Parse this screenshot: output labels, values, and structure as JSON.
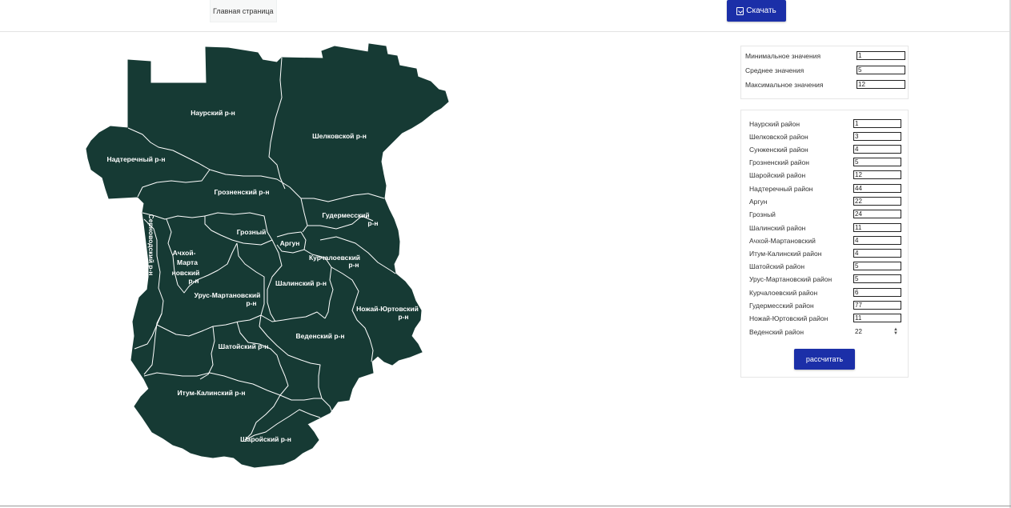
{
  "header": {
    "home_label": "Главная страница",
    "download_label": "Скачать"
  },
  "colors": {
    "map_fill": "#163a34",
    "border": "#ffffff",
    "accent_button": "#1b2fa8"
  },
  "map": {
    "labels": {
      "naur": "Наурский р-н",
      "shelk": "Шелковской р-н",
      "nadter": "Надтеречный р-н",
      "grozn_r": "Грозненский р-н",
      "gud_1": "Гудермесский",
      "gud_2": "р-н",
      "grozny": "Грозный",
      "argun": "Аргун",
      "sunzh": "Серноводский р-н",
      "achkh_1": "Ачхой-",
      "achkh_2": "Марта",
      "achkh_3": "новский",
      "achkh_4": "р-н",
      "kurch_1": "Курчалоевский",
      "kurch_2": "р-н",
      "shalin": "Шалинский р-н",
      "urus_1": "Урус-Мартановский",
      "urus_2": "р-н",
      "nozh_1": "Ножай-Юртовский",
      "nozh_2": "р-н",
      "veden": "Веденский р-н",
      "shatoi": "Шатойский р-н",
      "itum": "Итум-Калинский р-н",
      "sharoi": "Шаройский р-н"
    }
  },
  "thresholds": [
    {
      "label": "Минимальное значения",
      "value": "1"
    },
    {
      "label": "Среднее значения",
      "value": "5"
    },
    {
      "label": "Максимальное значения",
      "value": "12"
    }
  ],
  "districts": [
    {
      "label": "Наурский район",
      "value": "1"
    },
    {
      "label": "Шелковской район",
      "value": "3"
    },
    {
      "label": "Сунженский район",
      "value": "4"
    },
    {
      "label": "Грозненский район",
      "value": "5"
    },
    {
      "label": "Шаройский район",
      "value": "12"
    },
    {
      "label": "Надтеречный район",
      "value": "44"
    },
    {
      "label": "Аргун",
      "value": "22"
    },
    {
      "label": "Грозный",
      "value": "24"
    },
    {
      "label": "Шалинский район",
      "value": "11"
    },
    {
      "label": "Ачхой-Мартановский",
      "value": "4"
    },
    {
      "label": "Итум-Калинский район",
      "value": "4"
    },
    {
      "label": "Шатойский район",
      "value": "5"
    },
    {
      "label": "Урус-Мартановский район",
      "value": "5"
    },
    {
      "label": "Курчалоевский район",
      "value": "6"
    },
    {
      "label": "Гудермесский район",
      "value": "77"
    },
    {
      "label": "Ножай-Юртовский район",
      "value": "11"
    },
    {
      "label": "Веденский район",
      "value": "22"
    }
  ],
  "calculate_label": "рассчитать"
}
